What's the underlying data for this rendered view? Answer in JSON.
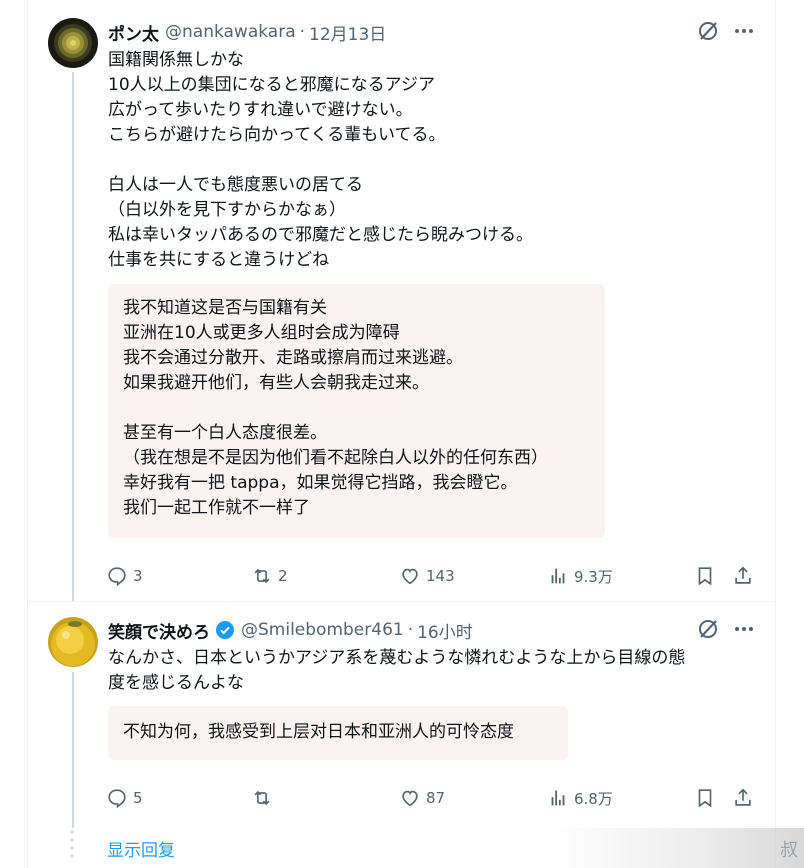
{
  "tweets": [
    {
      "name": "ポン太",
      "handle": "@nankawakara",
      "dot": "·",
      "time": "12月13日",
      "text": "国籍関係無しかな\n10人以上の集団になると邪魔になるアジア\n広がって歩いたりすれ違いで避けない。\nこちらが避けたら向かってくる輩もいてる。\n\n白人は一人でも態度悪いの居てる\n（白以外を見下すからかなぁ）\n私は幸いタッパあるので邪魔だと感じたら睨みつける。\n仕事を共にすると違うけどね",
      "translation": "我不知道这是否与国籍有关\n亚洲在10人或更多人组时会成为障碍\n我不会通过分散开、走路或擦肩而过来逃避。\n如果我避开他们，有些人会朝我走过来。\n\n甚至有一个白人态度很差。\n（我在想是不是因为他们看不起除白人以外的任何东西）\n幸好我有一把 tappa，如果觉得它挡路，我会瞪它。\n我们一起工作就不一样了",
      "replies": "3",
      "reposts": "2",
      "likes": "143",
      "views": "9.3万"
    },
    {
      "name": "笑顔で決めろ",
      "handle": "@Smilebomber461",
      "dot": "·",
      "time": "16小时",
      "text": "なんかさ、日本というかアジア系を蔑むような憐れむような上から目線の態\n度を感じるんよな",
      "translation": "不知为何，我感受到上层对日本和亚洲人的可怜态度",
      "replies": "5",
      "reposts": "",
      "likes": "87",
      "views": "6.8万"
    }
  ],
  "show_replies": "显示回复",
  "watermark_text": "叔",
  "colors": {
    "accent": "#1d9bf0",
    "secondary_text": "#536471",
    "translation_bg": "#faf3f2"
  }
}
